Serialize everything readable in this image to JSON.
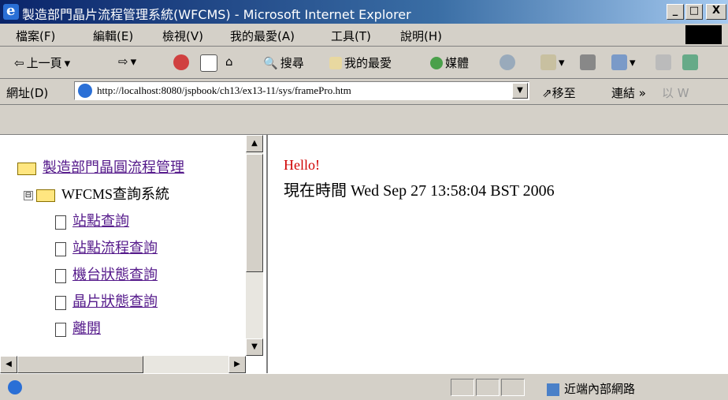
{
  "window": {
    "title": "製造部門晶片流程管理系統(WFCMS) - Microsoft Internet Explorer"
  },
  "window_controls": {
    "minimize": "_",
    "maximize": "□",
    "close": "X"
  },
  "menu": [
    "檔案(F)",
    "編輯(E)",
    "檢視(V)",
    "我的最愛(A)",
    "工具(T)",
    "說明(H)"
  ],
  "toolbar": {
    "back": "上一頁",
    "search": "搜尋",
    "favorites": "我的最愛",
    "media": "媒體"
  },
  "address": {
    "label": "網址(D)",
    "url": "http://localhost:8080/jspbook/ch13/ex13-11/sys/framePro.htm",
    "go": "移至",
    "links": "連結",
    "links_more": "»",
    "extra": "以 W"
  },
  "tree": {
    "root": "製造部門晶圓流程管理",
    "system": "WFCMS查詢系統",
    "expander": "⊟",
    "items": [
      "站點查詢",
      "站點流程查詢",
      "機台狀態查詢",
      "晶片狀態查詢",
      "離開"
    ]
  },
  "main": {
    "greeting": "Hello!",
    "time": "現在時間 Wed Sep 27 13:58:04 BST 2006"
  },
  "status": {
    "zone": "近端內部網路"
  },
  "colors": {
    "title_start": "#0a246a",
    "hello": "#d00000",
    "link": "#551a8b"
  }
}
